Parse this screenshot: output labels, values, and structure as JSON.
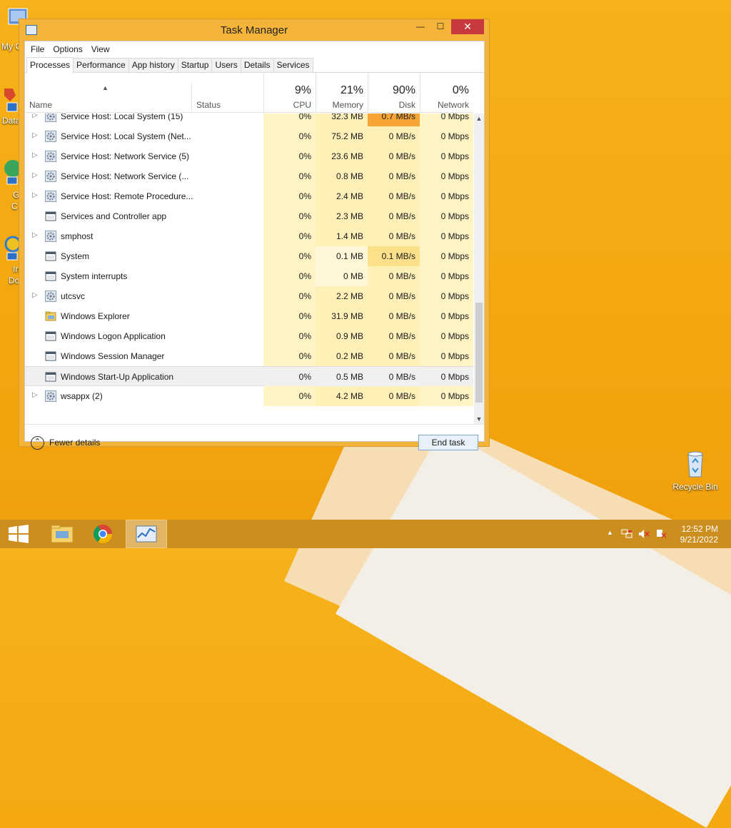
{
  "desktop": {
    "partials": [
      "My C",
      "Data",
      "G",
      "C",
      "In",
      "Do"
    ],
    "recycle_label": "Recycle Bin"
  },
  "window": {
    "title": "Task Manager",
    "close_glyph": "✕",
    "min_glyph": "—",
    "max_glyph": "☐"
  },
  "menu": [
    "File",
    "Options",
    "View"
  ],
  "tabs": [
    "Processes",
    "Performance",
    "App history",
    "Startup",
    "Users",
    "Details",
    "Services"
  ],
  "header": {
    "name": "Name",
    "status": "Status",
    "cpu": {
      "pct": "9%",
      "label": "CPU"
    },
    "memory": {
      "pct": "21%",
      "label": "Memory"
    },
    "disk": {
      "pct": "90%",
      "label": "Disk"
    },
    "network": {
      "pct": "0%",
      "label": "Network"
    }
  },
  "rows": [
    {
      "name": "Service Host: Local System (15)",
      "expand": true,
      "icon": "gear",
      "cpu": "0%",
      "mem": "32.3 MB",
      "disk": "0.7 MB/s",
      "net": "0 Mbps"
    },
    {
      "name": "Service Host: Local System (Net...",
      "expand": true,
      "icon": "gear",
      "cpu": "0%",
      "mem": "75.2 MB",
      "disk": "0 MB/s",
      "net": "0 Mbps"
    },
    {
      "name": "Service Host: Network Service (5)",
      "expand": true,
      "icon": "gear",
      "cpu": "0%",
      "mem": "23.6 MB",
      "disk": "0 MB/s",
      "net": "0 Mbps"
    },
    {
      "name": "Service Host: Network Service (...",
      "expand": true,
      "icon": "gear",
      "cpu": "0%",
      "mem": "0.8 MB",
      "disk": "0 MB/s",
      "net": "0 Mbps"
    },
    {
      "name": "Service Host: Remote Procedure...",
      "expand": true,
      "icon": "gear",
      "cpu": "0%",
      "mem": "2.4 MB",
      "disk": "0 MB/s",
      "net": "0 Mbps"
    },
    {
      "name": "Services and Controller app",
      "expand": false,
      "icon": "window",
      "cpu": "0%",
      "mem": "2.3 MB",
      "disk": "0 MB/s",
      "net": "0 Mbps"
    },
    {
      "name": "smphost",
      "expand": true,
      "icon": "gear",
      "cpu": "0%",
      "mem": "1.4 MB",
      "disk": "0 MB/s",
      "net": "0 Mbps"
    },
    {
      "name": "System",
      "expand": false,
      "icon": "window",
      "cpu": "0%",
      "mem": "0.1 MB",
      "disk": "0.1 MB/s",
      "net": "0 Mbps"
    },
    {
      "name": "System interrupts",
      "expand": false,
      "icon": "window",
      "cpu": "0%",
      "mem": "0 MB",
      "disk": "0 MB/s",
      "net": "0 Mbps"
    },
    {
      "name": "utcsvc",
      "expand": true,
      "icon": "gear",
      "cpu": "0%",
      "mem": "2.2 MB",
      "disk": "0 MB/s",
      "net": "0 Mbps"
    },
    {
      "name": "Windows Explorer",
      "expand": false,
      "icon": "folder",
      "cpu": "0%",
      "mem": "31.9 MB",
      "disk": "0 MB/s",
      "net": "0 Mbps"
    },
    {
      "name": "Windows Logon Application",
      "expand": false,
      "icon": "window",
      "cpu": "0%",
      "mem": "0.9 MB",
      "disk": "0 MB/s",
      "net": "0 Mbps"
    },
    {
      "name": "Windows Session Manager",
      "expand": false,
      "icon": "window",
      "cpu": "0%",
      "mem": "0.2 MB",
      "disk": "0 MB/s",
      "net": "0 Mbps"
    },
    {
      "name": "Windows Start-Up Application",
      "expand": false,
      "icon": "window",
      "cpu": "0%",
      "mem": "0.5 MB",
      "disk": "0 MB/s",
      "net": "0 Mbps",
      "selected": true
    },
    {
      "name": "wsappx (2)",
      "expand": true,
      "icon": "gear",
      "cpu": "0%",
      "mem": "4.2 MB",
      "disk": "0 MB/s",
      "net": "0 Mbps"
    }
  ],
  "footer": {
    "fewer_details": "Fewer details",
    "end_task": "End task"
  },
  "taskbar": {
    "time": "12:52 PM",
    "date": "9/21/2022"
  },
  "colors": {
    "cpu_bg": "#fff4c4",
    "mem_bg": "#fff0b8",
    "mem_bg_light": "#fff7d6",
    "disk_bg": "#fff0b8",
    "disk_hot": "#f6a534",
    "disk_warm": "#fde08a",
    "net_bg": "#fff4c4"
  }
}
